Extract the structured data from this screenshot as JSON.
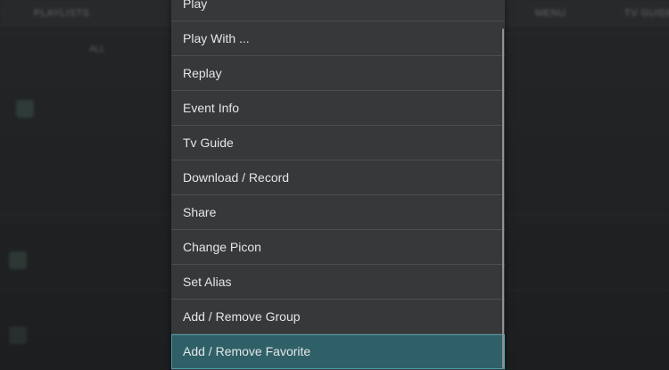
{
  "background": {
    "tabs": [
      "PLAYLISTS",
      "",
      "",
      "",
      "MENU",
      "TV GUIDE"
    ],
    "filters": [
      "",
      "ALL",
      "",
      "",
      "",
      "",
      "",
      "",
      "",
      ""
    ]
  },
  "context_menu": {
    "items": [
      {
        "label": "Play",
        "selected": false
      },
      {
        "label": "Play With ...",
        "selected": false
      },
      {
        "label": "Replay",
        "selected": false
      },
      {
        "label": "Event Info",
        "selected": false
      },
      {
        "label": "Tv Guide",
        "selected": false
      },
      {
        "label": "Download / Record",
        "selected": false
      },
      {
        "label": "Share",
        "selected": false
      },
      {
        "label": "Change Picon",
        "selected": false
      },
      {
        "label": "Set Alias",
        "selected": false
      },
      {
        "label": "Add / Remove Group",
        "selected": false
      },
      {
        "label": "Add / Remove Favorite",
        "selected": true
      }
    ]
  },
  "colors": {
    "menu_background": "#36383a",
    "selected_background": "#2f6068",
    "selected_border": "#4f9aa4",
    "text": "#e6e6e6"
  }
}
